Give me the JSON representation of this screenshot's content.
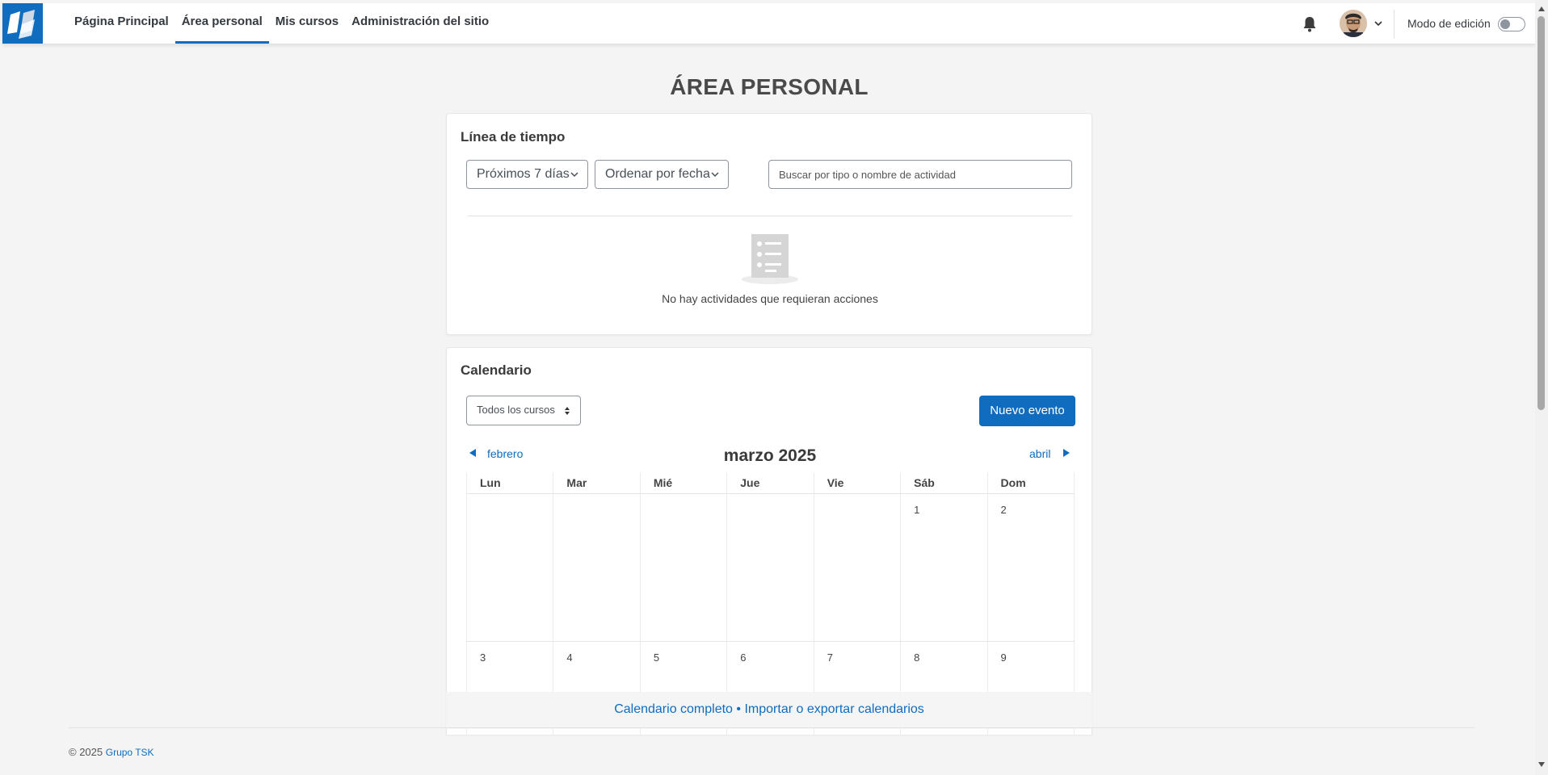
{
  "nav": {
    "items": [
      {
        "label": "Página Principal",
        "active": false
      },
      {
        "label": "Área personal",
        "active": true
      },
      {
        "label": "Mis cursos",
        "active": false
      },
      {
        "label": "Administración del sitio",
        "active": false
      }
    ],
    "edit_mode_label": "Modo de edición",
    "edit_mode_on": false,
    "icons": {
      "logo": "app-logo",
      "notifications": "bell-icon",
      "user_menu": "chevron-down-icon"
    }
  },
  "page": {
    "title": "ÁREA PERSONAL"
  },
  "timeline": {
    "title": "Línea de tiempo",
    "filter_label": "Próximos 7 días",
    "sort_label": "Ordenar por fecha",
    "search_placeholder": "Buscar por tipo o nombre de actividad",
    "empty_text": "No hay actividades que requieran acciones"
  },
  "calendar": {
    "title": "Calendario",
    "course_filter": "Todos los cursos",
    "new_event_label": "Nuevo evento",
    "prev_month": "febrero",
    "next_month": "abril",
    "current_month": "marzo 2025",
    "weekdays": [
      "Lun",
      "Mar",
      "Mié",
      "Jue",
      "Vie",
      "Sáb",
      "Dom"
    ],
    "weeks": [
      [
        "",
        "",
        "",
        "",
        "",
        "1",
        "2"
      ],
      [
        "3",
        "4",
        "5",
        "6",
        "7",
        "8",
        "9"
      ]
    ],
    "full_calendar_link": "Calendario completo",
    "separator": "•",
    "import_export_link": "Importar o exportar calendarios"
  },
  "footer": {
    "copyright": "© 2025",
    "company_link": "Grupo TSK"
  },
  "colors": {
    "primary": "#0f6cbf",
    "background": "#f4f4f4"
  }
}
